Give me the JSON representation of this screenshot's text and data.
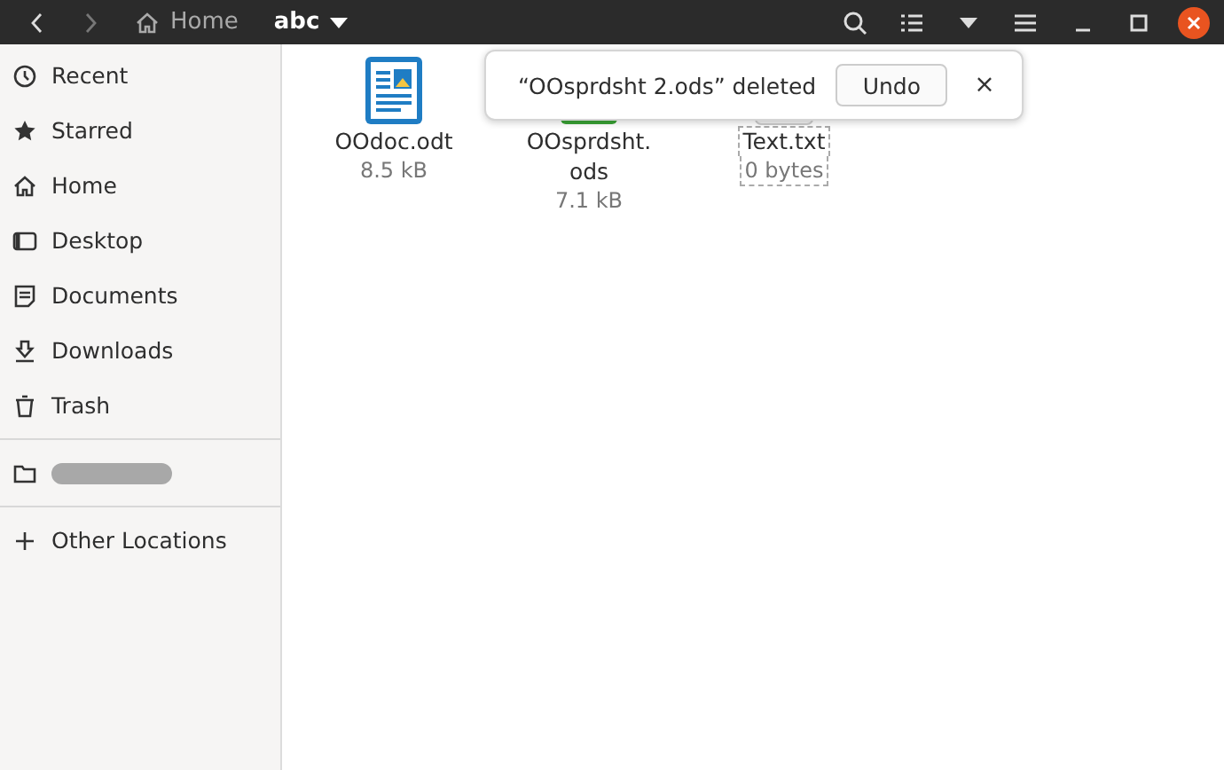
{
  "header": {
    "back": {
      "disabled": false
    },
    "forward": {
      "disabled": true
    },
    "path": [
      {
        "label": "Home",
        "kind": "home",
        "selected": false
      },
      {
        "label": "abc",
        "kind": "folder",
        "selected": true
      }
    ]
  },
  "sidebar": {
    "items": [
      {
        "label": "Recent",
        "kind": "recent"
      },
      {
        "label": "Starred",
        "kind": "starred"
      },
      {
        "label": "Home",
        "kind": "home"
      },
      {
        "label": "Desktop",
        "kind": "desktop"
      },
      {
        "label": "Documents",
        "kind": "documents"
      },
      {
        "label": "Downloads",
        "kind": "downloads"
      },
      {
        "label": "Trash",
        "kind": "trash"
      },
      {
        "kind": "redacted"
      },
      {
        "label": "Other Locations",
        "kind": "other"
      }
    ]
  },
  "files": [
    {
      "name": "OOdoc.odt",
      "size": "8.5 kB",
      "kind": "document",
      "focused": false
    },
    {
      "name": "OOsprdsht.",
      "name_2": "ods",
      "size": "7.1 kB",
      "kind": "spreadsheet",
      "focused": false
    },
    {
      "name": "Text.txt",
      "size": "0 bytes",
      "kind": "text",
      "focused": true
    }
  ],
  "toast": {
    "message": "“OOsprdsht 2.ods” deleted",
    "button": "Undo",
    "close": "×"
  }
}
